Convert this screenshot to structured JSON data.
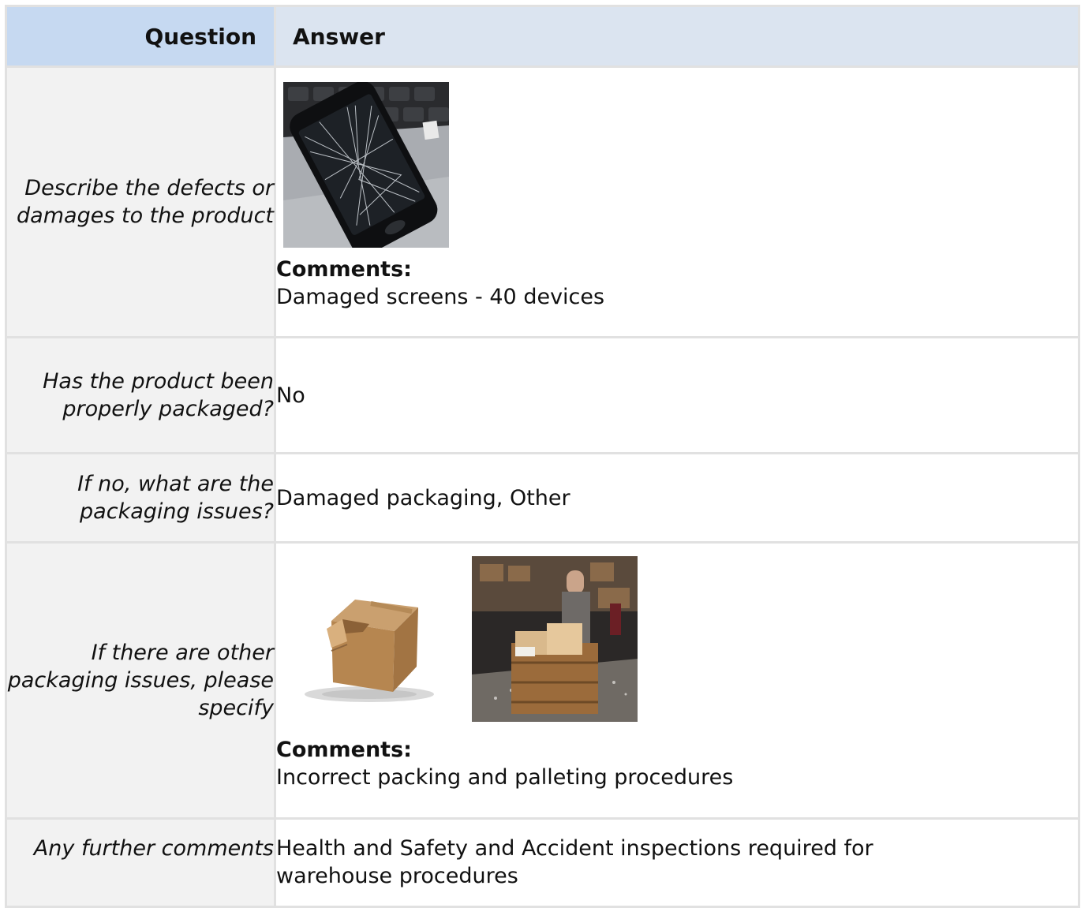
{
  "table": {
    "header": {
      "question": "Question",
      "answer": "Answer"
    },
    "rows": [
      {
        "question": "Describe the defects or damages to the product",
        "images": [
          "broken-phone-photo"
        ],
        "comments_label": "Comments:",
        "comments": "Damaged screens - 40 devices"
      },
      {
        "question": "Has the product been properly packaged?",
        "answer": "No"
      },
      {
        "question": "If no, what are the packaging issues?",
        "answer": "Damaged packaging, Other"
      },
      {
        "question": "If there are other packaging issues, please specify",
        "images": [
          "damaged-box-photo",
          "warehouse-pallet-photo"
        ],
        "comments_label": "Comments:",
        "comments": "Incorrect packing and palleting procedures"
      },
      {
        "question": "Any further comments",
        "answer": "Health and Safety and Accident inspections required for warehouse procedures"
      }
    ]
  }
}
